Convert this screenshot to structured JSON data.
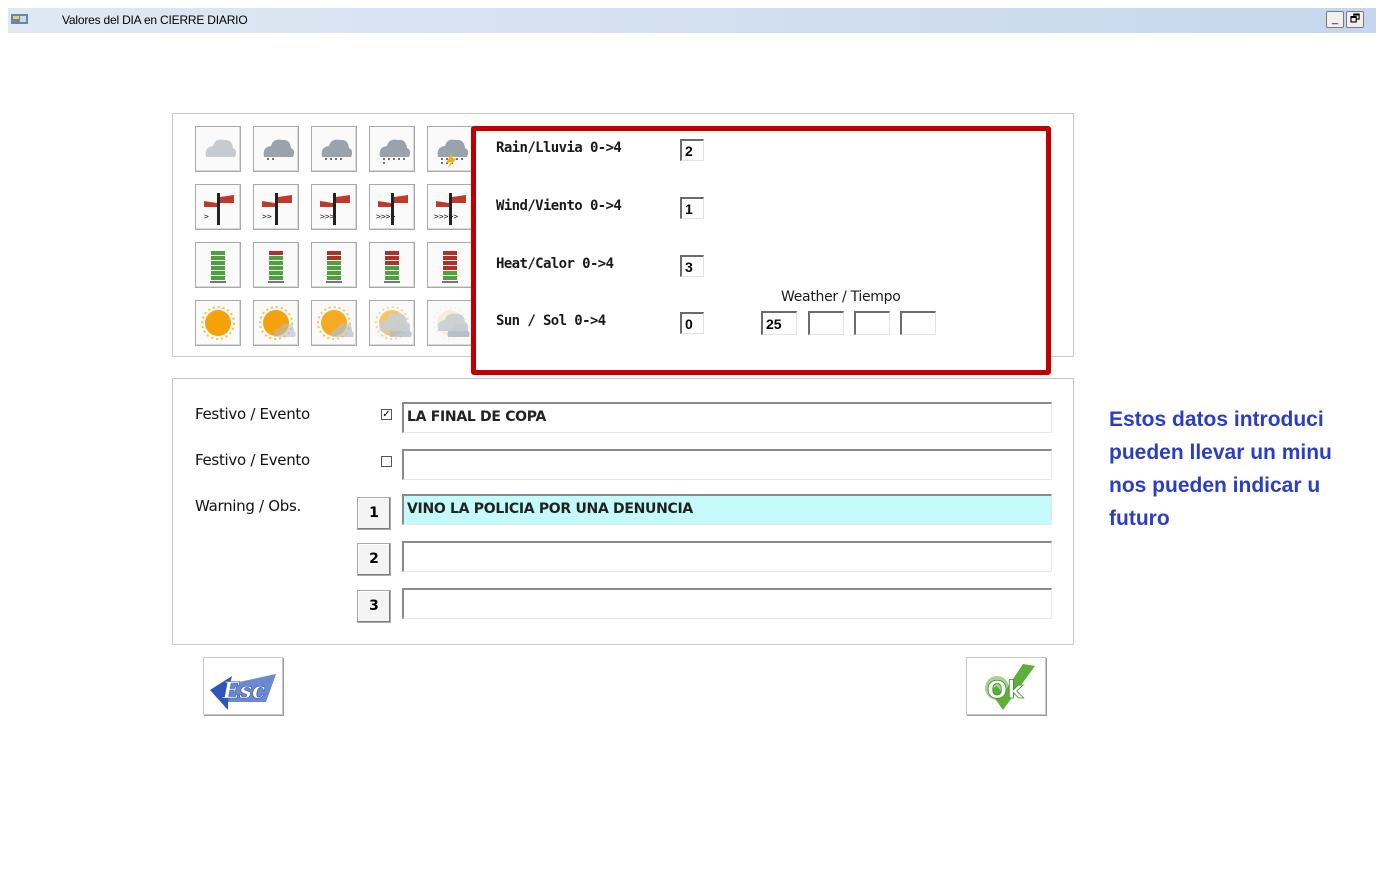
{
  "window": {
    "title": "Valores del DIA en CIERRE DIARIO",
    "minimize_label": "_",
    "restore_label": "🗗"
  },
  "weather": {
    "rows": [
      {
        "label": "Rain/Lluvia  0->4",
        "value": "2"
      },
      {
        "label": "Wind/Viento  0->4",
        "value": "1"
      },
      {
        "label": "Heat/Calor  0->4",
        "value": "3"
      },
      {
        "label": "Sun / Sol   0->4",
        "value": "0"
      }
    ],
    "tiempo_label": "Weather / Tiempo",
    "tiempo_values": [
      "25",
      "",
      "",
      ""
    ]
  },
  "events": [
    {
      "label": "Festivo / Evento",
      "checked": true,
      "check_glyph": "✓",
      "value": "LA FINAL DE COPA"
    },
    {
      "label": "Festivo / Evento",
      "checked": false,
      "check_glyph": "",
      "value": ""
    }
  ],
  "warnings": {
    "label": "Warning / Obs.",
    "rows": [
      {
        "button": "1",
        "value": "VINO LA POLICIA POR UNA DENUNCIA"
      },
      {
        "button": "2",
        "value": ""
      },
      {
        "button": "3",
        "value": ""
      }
    ]
  },
  "buttons": {
    "esc_label": "Esc",
    "ok_label": "Ok"
  },
  "note": {
    "text": "Estos datos introduci\npueden llevar un minu\nnos pueden indicar u\nfuturo"
  },
  "colors": {
    "highlight_border": "#c00000",
    "note_text": "#2b3ec2",
    "warning_field_bg": "#c4fafa"
  }
}
